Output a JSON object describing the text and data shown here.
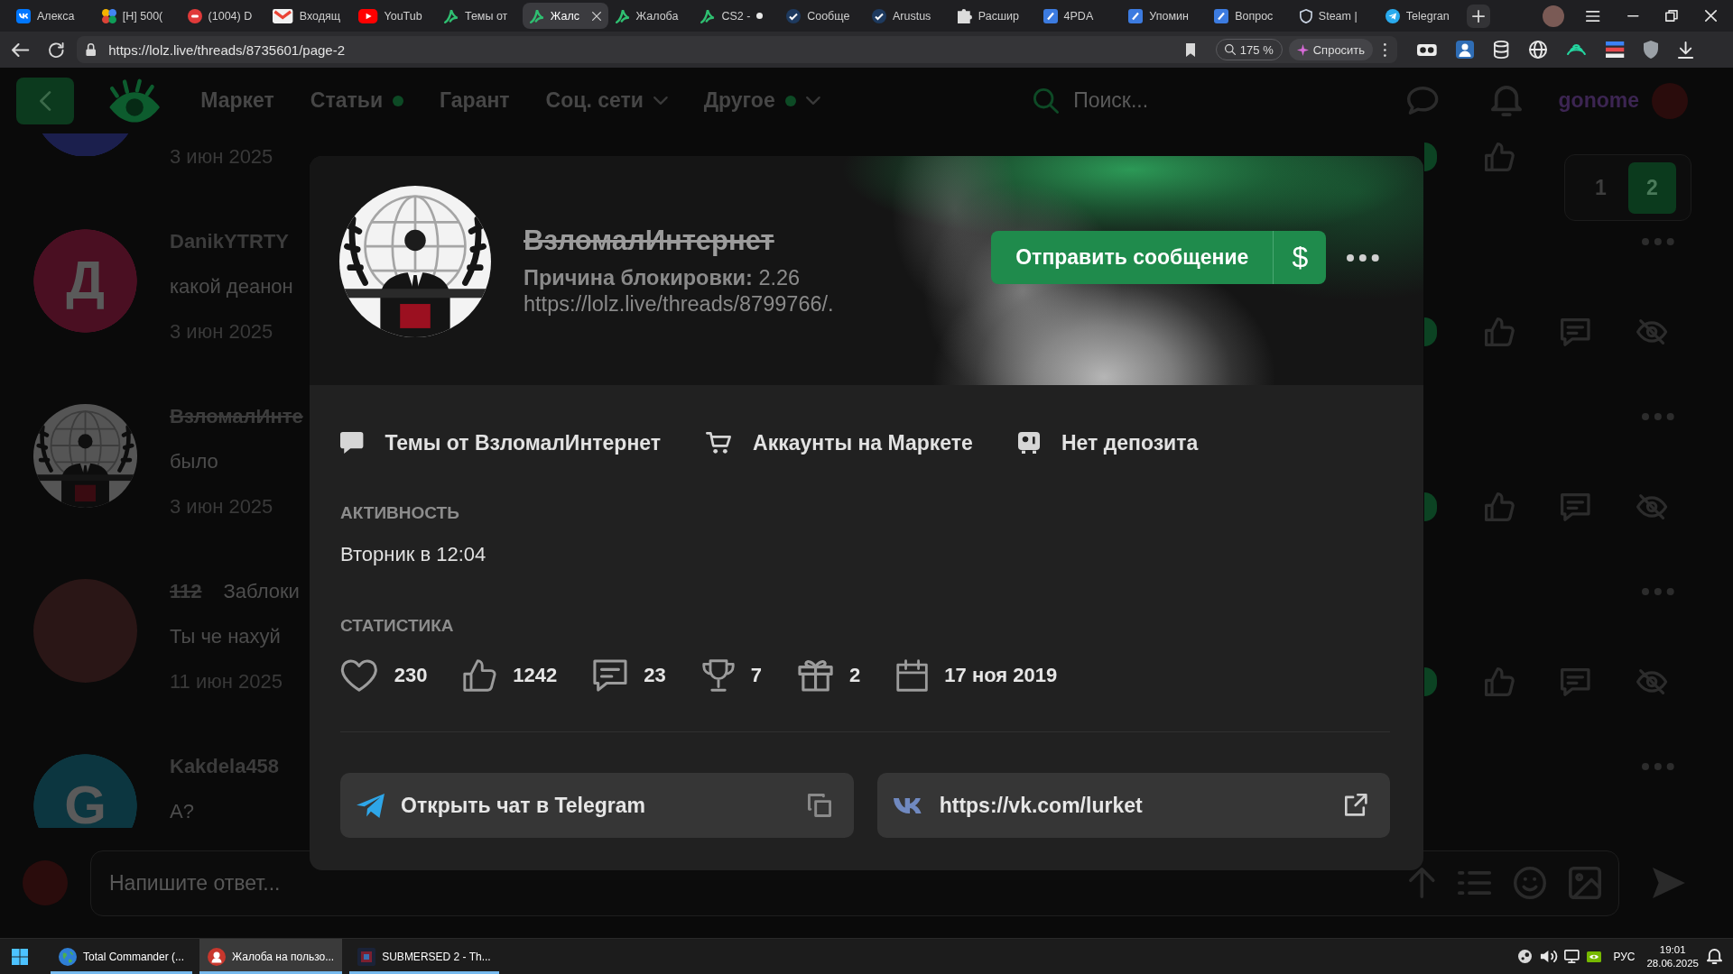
{
  "browser": {
    "tabs": [
      {
        "title": "Алекса",
        "kind": "vk",
        "selected": false,
        "unread": false
      },
      {
        "title": "[H] 500(",
        "kind": "pinwheel",
        "selected": false,
        "unread": false
      },
      {
        "title": "(1004) D",
        "kind": "counter",
        "selected": false,
        "unread": false
      },
      {
        "title": "Входящ",
        "kind": "mail",
        "selected": false,
        "unread": false
      },
      {
        "title": "YouTub",
        "kind": "video",
        "selected": false,
        "unread": false
      },
      {
        "title": "Темы от",
        "kind": "forum",
        "selected": false,
        "unread": false
      },
      {
        "title": "Жалс",
        "kind": "forum",
        "selected": true,
        "unread": false
      },
      {
        "title": "Жалоба",
        "kind": "forum",
        "selected": false,
        "unread": false
      },
      {
        "title": "CS2 -",
        "kind": "forum",
        "selected": false,
        "unread": true
      },
      {
        "title": "Сообще",
        "kind": "steam",
        "selected": false,
        "unread": false
      },
      {
        "title": "Arustus",
        "kind": "steam",
        "selected": false,
        "unread": false
      },
      {
        "title": "Расшир",
        "kind": "puzzle",
        "selected": false,
        "unread": false
      },
      {
        "title": "4PDA",
        "kind": "pda",
        "selected": false,
        "unread": false
      },
      {
        "title": "Упомин",
        "kind": "pda",
        "selected": false,
        "unread": false
      },
      {
        "title": "Вопрос",
        "kind": "pda",
        "selected": false,
        "unread": false
      },
      {
        "title": "Steam |",
        "kind": "shield",
        "selected": false,
        "unread": false
      },
      {
        "title": "Telegran",
        "kind": "telegram",
        "selected": false,
        "unread": false
      }
    ],
    "address": "https://lolz.live/threads/8735601/page-2",
    "zoom": "175 %",
    "ask": "Спросить"
  },
  "site_header": {
    "nav": [
      {
        "label": "Маркет",
        "dot": false,
        "dropdown": false
      },
      {
        "label": "Статьи",
        "dot": true,
        "dropdown": false
      },
      {
        "label": "Гарант",
        "dot": false,
        "dropdown": false
      },
      {
        "label": "Соц. сети",
        "dot": false,
        "dropdown": true
      },
      {
        "label": "Другое",
        "dot": true,
        "dropdown": true
      }
    ],
    "search": {
      "placeholder": "Поиск..."
    },
    "username": "gonome"
  },
  "posts": [
    {
      "date": "3 июн 2025",
      "avatar": {
        "kind": "letter",
        "color": "#1b1f4d"
      }
    },
    {
      "author": "DanikYTRTY",
      "banned": false,
      "message": "какой деанон",
      "date": "3 июн 2025",
      "avatar": {
        "kind": "letter",
        "letter": "Д",
        "color": "#4a0f22"
      }
    },
    {
      "author": "ВзломалИнте",
      "banned": true,
      "message": "было",
      "date": "3 июн 2025",
      "avatar": {
        "kind": "emblem"
      }
    },
    {
      "author": "112",
      "banned": true,
      "status": "Заблоки",
      "message": "Ты че нахуй",
      "date": "11 июн 2025",
      "avatar": {
        "kind": "picture"
      }
    },
    {
      "author": "Kakdela458",
      "banned": false,
      "message": "А?",
      "avatar": {
        "kind": "letter",
        "letter": "G",
        "color": "#0c3640"
      }
    }
  ],
  "pagination": [
    {
      "label": "1",
      "selected": false
    },
    {
      "label": "2",
      "selected": true
    }
  ],
  "reply": {
    "placeholder": "Напишите ответ..."
  },
  "profile": {
    "name": "ВзломалИнтернет",
    "banned": true,
    "ban_reason": "**Причина блокировки:** 2.26 https://lolz.live/threads/8799766/.",
    "message_button": "Отправить сообщение",
    "money_button": "$",
    "links": [
      {
        "kind": "threads",
        "label": "Темы от ВзломалИнтернет"
      },
      {
        "kind": "market",
        "label": "Аккаунты на Маркете"
      },
      {
        "kind": "deposit",
        "label": "Нет депозита"
      }
    ],
    "activity_title": "АКТИВНОСТЬ",
    "activity": "Вторник в 12:04",
    "stats_title": "СТАТИСТИКА",
    "stats": [
      {
        "kind": "likes",
        "value": "230"
      },
      {
        "kind": "thumbs",
        "value": "1242"
      },
      {
        "kind": "messages",
        "value": "23"
      },
      {
        "kind": "trophies",
        "value": "7"
      },
      {
        "kind": "gifts",
        "value": "2"
      },
      {
        "kind": "registered",
        "value": "17 ноя 2019"
      }
    ],
    "contacts": [
      {
        "kind": "telegram",
        "label": "Открыть чат в Telegram",
        "copyable": true
      },
      {
        "kind": "vk",
        "label": "https://vk.com/lurket",
        "copyable": false
      }
    ]
  },
  "taskbar": {
    "apps": [
      {
        "label": "Total Commander (...",
        "kind": "globe",
        "selected": false
      },
      {
        "label": "Жалоба на пользо...",
        "kind": "browser",
        "selected": true
      },
      {
        "label": "SUBMERSED 2 - Th...",
        "kind": "game",
        "selected": false
      }
    ],
    "language": "РУС",
    "time": "19:01",
    "date": "28.06.2025"
  }
}
